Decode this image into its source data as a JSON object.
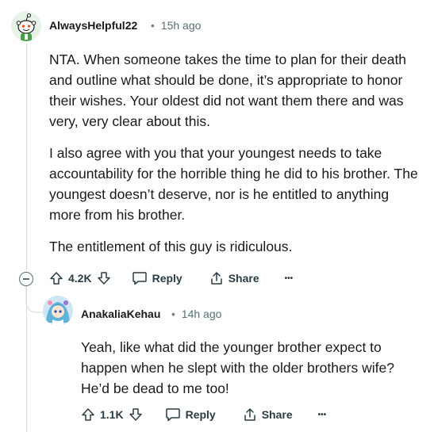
{
  "comment": {
    "author": "AlwaysHelpful22",
    "separator": "•",
    "time": "15h ago",
    "paragraphs": [
      "NTA. When someone takes the time to plan for their death and outline what should be done, it’s appropriate to honor their wishes. Your oldest did not want them there and was very, very clear about this.",
      "I also agree with you that your youngest needs to take accountability for the horrible thing he did to his brother. The youngest doesn’t deserve, nor is he entitled to anything more from his brother.",
      "The entitlement of this guy is ridiculous."
    ],
    "actions": {
      "upvotes": "4.2K",
      "reply": "Reply",
      "share": "Share",
      "more": "•••"
    }
  },
  "reply": {
    "author": "AnakaliaKehau",
    "separator": "•",
    "time": "14h ago",
    "paragraphs": [
      "Yeah, like what did the younger brother expect to happen when he slept with the older brothers wife? He’d be dead to me too!"
    ],
    "actions": {
      "upvotes": "1.1K",
      "reply": "Reply",
      "share": "Share",
      "more": "•••"
    }
  },
  "colors": {
    "text": "#1a1a1b",
    "meta": "#576f76",
    "thread_line": "#d7dadc",
    "snoo_bg": "#e8f3e8"
  },
  "icons": [
    "snoo-avatar",
    "anime-avatar",
    "collapse-icon",
    "upvote-icon",
    "downvote-icon",
    "comment-icon",
    "share-icon",
    "more-icon"
  ]
}
